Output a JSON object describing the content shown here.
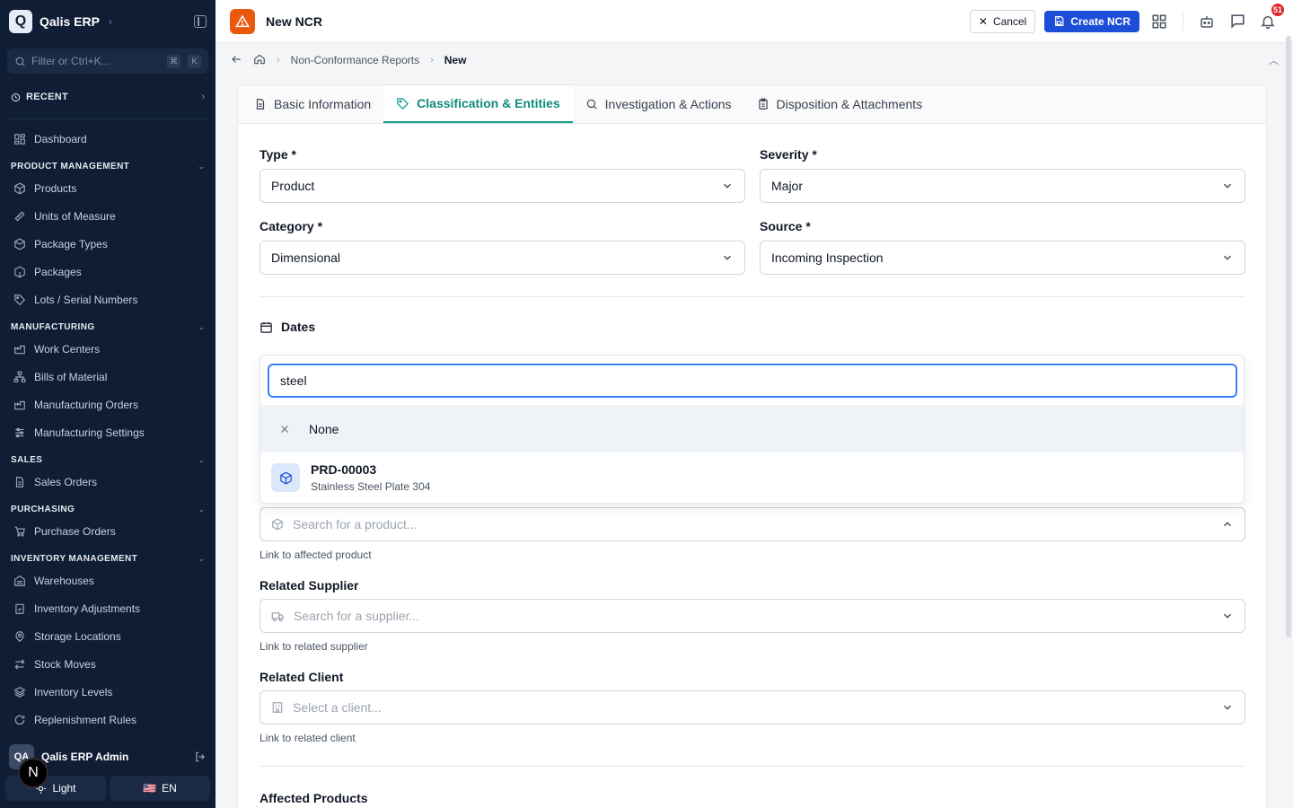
{
  "app": {
    "logo_letter": "Q",
    "name": "Qalis ERP",
    "filter_placeholder": "Filter or Ctrl+K...",
    "kbd1": "⌘",
    "kbd2": "K",
    "recent": "RECENT"
  },
  "sidebar": {
    "dashboard": "Dashboard",
    "sections": [
      {
        "title": "PRODUCT MANAGEMENT",
        "items": [
          "Products",
          "Units of Measure",
          "Package Types",
          "Packages",
          "Lots / Serial Numbers"
        ]
      },
      {
        "title": "MANUFACTURING",
        "items": [
          "Work Centers",
          "Bills of Material",
          "Manufacturing Orders",
          "Manufacturing Settings"
        ]
      },
      {
        "title": "SALES",
        "items": [
          "Sales Orders"
        ]
      },
      {
        "title": "PURCHASING",
        "items": [
          "Purchase Orders"
        ]
      },
      {
        "title": "INVENTORY MANAGEMENT",
        "items": [
          "Warehouses",
          "Inventory Adjustments",
          "Storage Locations",
          "Stock Moves",
          "Inventory Levels",
          "Replenishment Rules"
        ]
      }
    ],
    "user_initials": "QA",
    "user_name": "Qalis ERP Admin",
    "theme_label": "Light",
    "lang_flag": "🇺🇸",
    "lang_label": "EN",
    "n_badge": "N"
  },
  "header": {
    "title": "New NCR",
    "cancel": "Cancel",
    "create": "Create NCR",
    "notif_count": "51"
  },
  "breadcrumb": {
    "parent": "Non-Conformance Reports",
    "current": "New"
  },
  "tabs": [
    "Basic Information",
    "Classification & Entities",
    "Investigation & Actions",
    "Disposition & Attachments"
  ],
  "form": {
    "type_label": "Type *",
    "type_value": "Product",
    "severity_label": "Severity *",
    "severity_value": "Major",
    "category_label": "Category *",
    "category_value": "Dimensional",
    "source_label": "Source *",
    "source_value": "Incoming Inspection",
    "dates_title": "Dates",
    "product_placeholder": "Search for a product...",
    "product_helper": "Link to affected product",
    "supplier_label": "Related Supplier",
    "supplier_placeholder": "Search for a supplier...",
    "supplier_helper": "Link to related supplier",
    "client_label": "Related Client",
    "client_placeholder": "Select a client...",
    "client_helper": "Link to related client",
    "affected_title": "Affected Products"
  },
  "dropdown": {
    "search_value": "steel",
    "none_label": "None",
    "option_code": "PRD-00003",
    "option_desc": "Stainless Steel Plate 304"
  },
  "colors": {
    "sidebar_bg": "#0f1d35",
    "primary": "#1d4ed8",
    "accent_tab": "#0f9d8e",
    "alert": "#ea580c",
    "badge": "#dc2626"
  }
}
